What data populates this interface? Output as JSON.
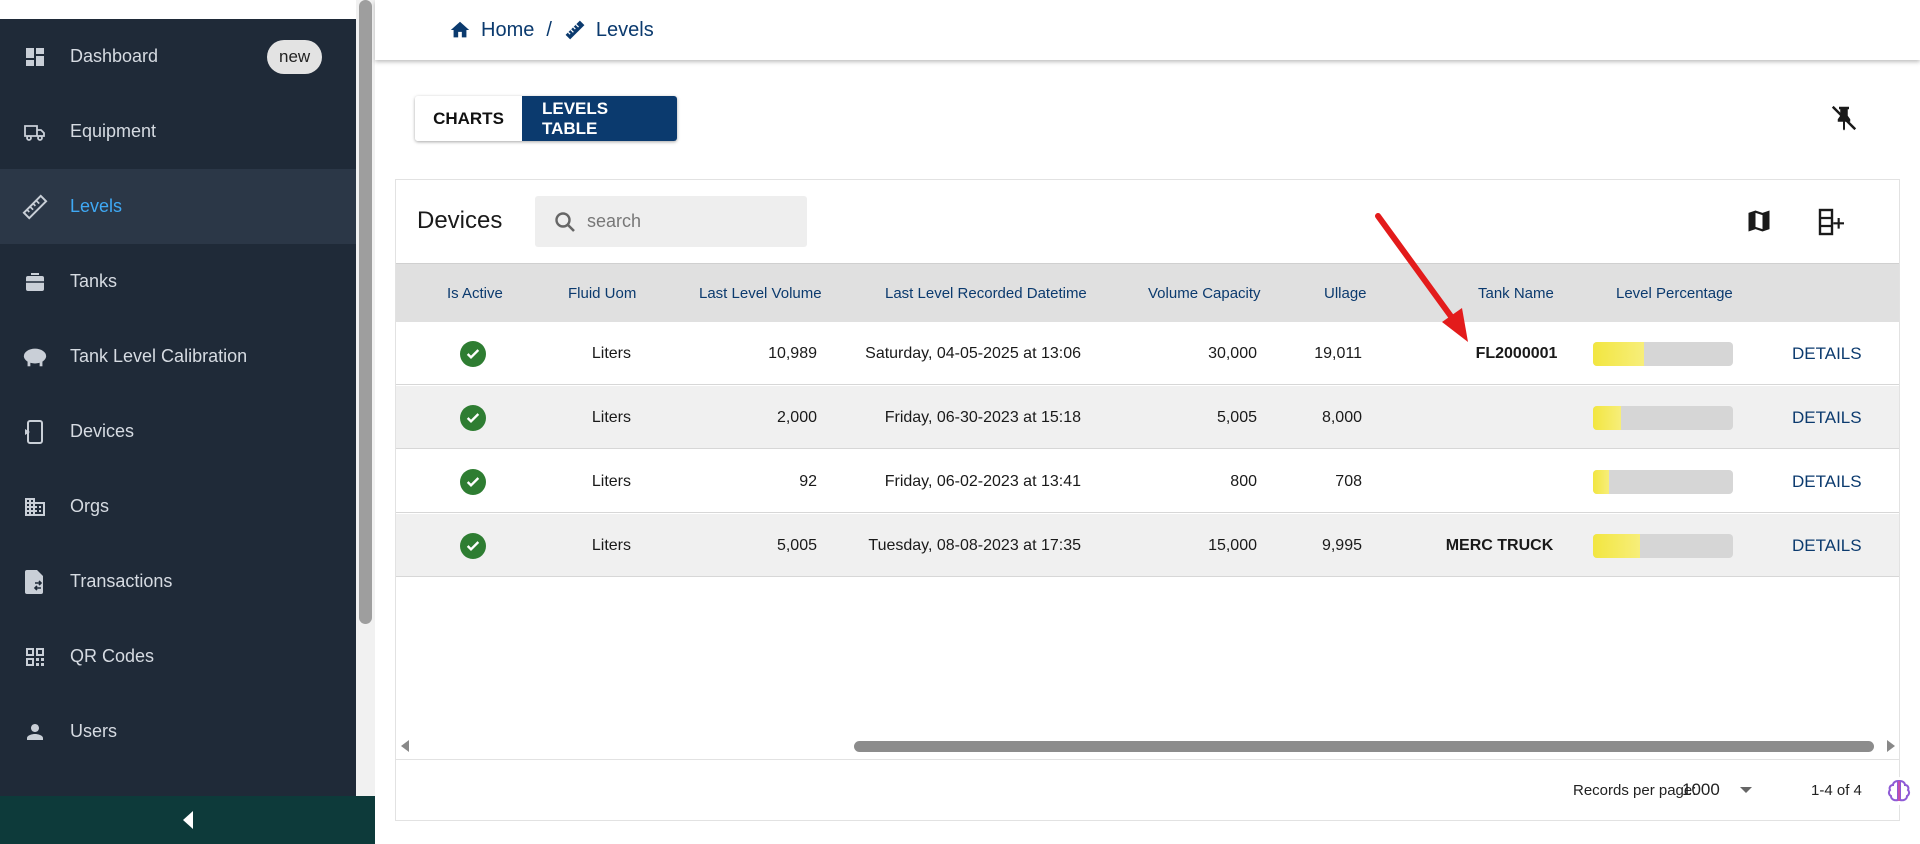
{
  "sidebar": {
    "items": [
      {
        "label": "Dashboard",
        "icon": "dashboard-icon",
        "badge": "new"
      },
      {
        "label": "Equipment",
        "icon": "truck-icon"
      },
      {
        "label": "Levels",
        "icon": "ruler-icon",
        "active": true
      },
      {
        "label": "Tanks",
        "icon": "tank-icon"
      },
      {
        "label": "Tank Level Calibration",
        "icon": "calibration-icon"
      },
      {
        "label": "Devices",
        "icon": "device-icon"
      },
      {
        "label": "Orgs",
        "icon": "building-icon"
      },
      {
        "label": "Transactions",
        "icon": "transaction-icon"
      },
      {
        "label": "QR Codes",
        "icon": "qr-code-icon"
      },
      {
        "label": "Users",
        "icon": "user-icon"
      }
    ]
  },
  "breadcrumb": {
    "home": "Home",
    "separator": "/",
    "current": "Levels"
  },
  "view_toggle": {
    "charts": "CHARTS",
    "levels_table": "LEVELS TABLE",
    "selected": "LEVELS TABLE"
  },
  "devices": {
    "title": "Devices",
    "search_placeholder": "search"
  },
  "table": {
    "columns": [
      "Is Active",
      "Fluid Uom",
      "Last Level Volume",
      "Last Level Recorded Datetime",
      "Volume Capacity",
      "Ullage",
      "Tank Name",
      "Level Percentage"
    ],
    "rows": [
      {
        "active": true,
        "fluid_uom": "Liters",
        "last_level_volume": "10,989",
        "datetime": "Saturday, 04-05-2025 at 13:06",
        "capacity": "30,000",
        "ullage": "19,011",
        "tank_name": "FL2000001",
        "level_pct": 36.6,
        "action": "DETAILS"
      },
      {
        "active": true,
        "fluid_uom": "Liters",
        "last_level_volume": "2,000",
        "datetime": "Friday, 06-30-2023 at 15:18",
        "capacity": "5,005",
        "ullage": "8,000",
        "tank_name": "",
        "level_pct": 20,
        "action": "DETAILS"
      },
      {
        "active": true,
        "fluid_uom": "Liters",
        "last_level_volume": "92",
        "datetime": "Friday, 06-02-2023 at 13:41",
        "capacity": "800",
        "ullage": "708",
        "tank_name": "",
        "level_pct": 11.5,
        "action": "DETAILS"
      },
      {
        "active": true,
        "fluid_uom": "Liters",
        "last_level_volume": "5,005",
        "datetime": "Tuesday, 08-08-2023 at 17:35",
        "capacity": "15,000",
        "ullage": "9,995",
        "tank_name": "MERC TRUCK",
        "level_pct": 33.4,
        "action": "DETAILS"
      }
    ]
  },
  "pagination": {
    "records_per_page_label": "Records per page:",
    "records_per_page": "1000",
    "range": "1-4 of 4"
  },
  "colors": {
    "sidebar_bg": "#1f2a38",
    "accent": "#0b3a6e",
    "active_link": "#3fa9f5",
    "active_check": "#2e7d32",
    "level_fill": "#f2e640",
    "annotation_arrow": "#e31b1b"
  }
}
